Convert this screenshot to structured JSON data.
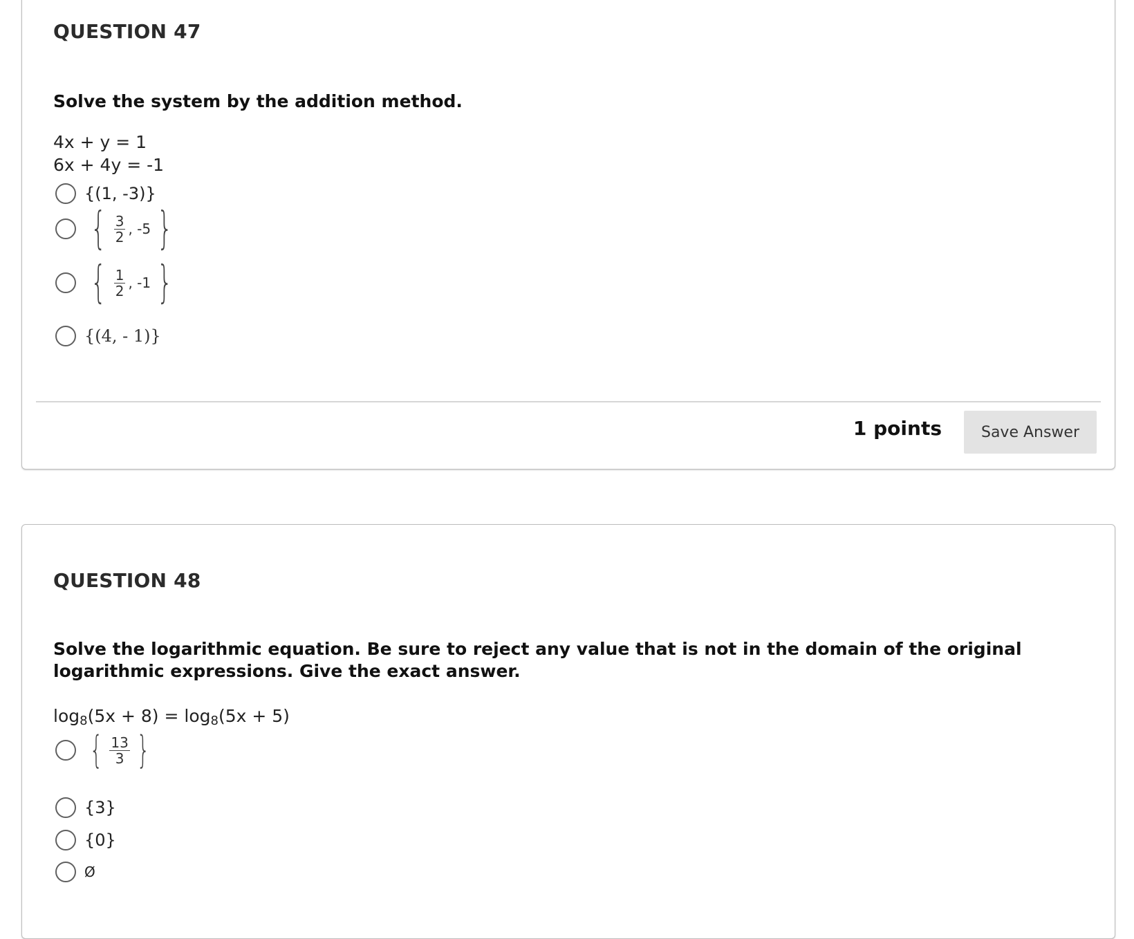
{
  "q47": {
    "title": "QUESTION 47",
    "prompt": "Solve the system by the addition method.",
    "equations": [
      "4x + y = 1",
      "6x + 4y = -1"
    ],
    "options": [
      {
        "text": "{(1, -3)}"
      },
      {
        "frac_num": "3",
        "frac_den": "2",
        "tail": ", -5"
      },
      {
        "frac_num": "1",
        "frac_den": "2",
        "tail": ", -1"
      },
      {
        "text": "{(4, - 1)}"
      }
    ],
    "points": "1 points",
    "save_label": "Save Answer"
  },
  "q48": {
    "title": "QUESTION 48",
    "prompt": "Solve the logarithmic equation. Be sure to reject any value that is not in the domain of the original logarithmic expressions. Give the exact answer.",
    "equation_left_log": "log",
    "equation_left_base": "8",
    "equation_left_arg": "(5x + 8) = ",
    "equation_right_log": "log",
    "equation_right_base": "8",
    "equation_right_arg": "(5x + 5)",
    "options": [
      {
        "frac_num": "13",
        "frac_den": "3"
      },
      {
        "text": "{3}"
      },
      {
        "text": "{0}"
      },
      {
        "text": "Ø"
      }
    ]
  }
}
